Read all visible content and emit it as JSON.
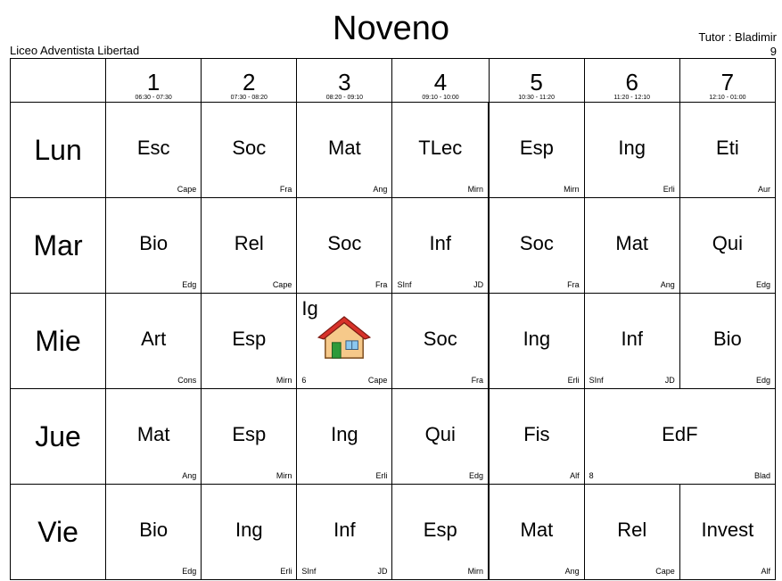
{
  "title": "Noveno",
  "school": "Liceo Adventista Libertad",
  "tutor": {
    "label": "Tutor : Bladimir",
    "group": "9"
  },
  "periods": [
    {
      "num": "1",
      "time": "06:30 - 07:30"
    },
    {
      "num": "2",
      "time": "07:30 - 08:20"
    },
    {
      "num": "3",
      "time": "08:20 - 09:10"
    },
    {
      "num": "4",
      "time": "09:10 - 10:00"
    },
    {
      "num": "5",
      "time": "10:30 - 11:20"
    },
    {
      "num": "6",
      "time": "11:20 - 12:10"
    },
    {
      "num": "7",
      "time": "12:10 - 01:00"
    }
  ],
  "days": [
    {
      "name": "Lun",
      "cells": [
        {
          "subject": "Esc",
          "room": "",
          "teacher": "Cape"
        },
        {
          "subject": "Soc",
          "room": "",
          "teacher": "Fra"
        },
        {
          "subject": "Mat",
          "room": "",
          "teacher": "Ang"
        },
        {
          "subject": "TLec",
          "room": "",
          "teacher": "Mirn"
        },
        {
          "subject": "Esp",
          "room": "",
          "teacher": "Mirn"
        },
        {
          "subject": "Ing",
          "room": "",
          "teacher": "Erli"
        },
        {
          "subject": "Eti",
          "room": "",
          "teacher": "Aur"
        }
      ]
    },
    {
      "name": "Mar",
      "cells": [
        {
          "subject": "Bio",
          "room": "",
          "teacher": "Edg"
        },
        {
          "subject": "Rel",
          "room": "",
          "teacher": "Cape"
        },
        {
          "subject": "Soc",
          "room": "",
          "teacher": "Fra"
        },
        {
          "subject": "Inf",
          "room": "SInf",
          "teacher": "JD"
        },
        {
          "subject": "Soc",
          "room": "",
          "teacher": "Fra"
        },
        {
          "subject": "Mat",
          "room": "",
          "teacher": "Ang"
        },
        {
          "subject": "Qui",
          "room": "",
          "teacher": "Edg"
        }
      ]
    },
    {
      "name": "Mie",
      "cells": [
        {
          "subject": "Art",
          "room": "",
          "teacher": "Cons"
        },
        {
          "subject": "Esp",
          "room": "",
          "teacher": "Mirn"
        },
        {
          "subject": "Ig",
          "room": "6",
          "teacher": "Cape",
          "icon": "house-icon"
        },
        {
          "subject": "Soc",
          "room": "",
          "teacher": "Fra"
        },
        {
          "subject": "Ing",
          "room": "",
          "teacher": "Erli"
        },
        {
          "subject": "Inf",
          "room": "SInf",
          "teacher": "JD"
        },
        {
          "subject": "Bio",
          "room": "",
          "teacher": "Edg"
        }
      ]
    },
    {
      "name": "Jue",
      "cells": [
        {
          "subject": "Mat",
          "room": "",
          "teacher": "Ang"
        },
        {
          "subject": "Esp",
          "room": "",
          "teacher": "Mirn"
        },
        {
          "subject": "Ing",
          "room": "",
          "teacher": "Erli"
        },
        {
          "subject": "Qui",
          "room": "",
          "teacher": "Edg"
        },
        {
          "subject": "Fis",
          "room": "",
          "teacher": "Alf"
        },
        {
          "subject": "EdF",
          "room": "8",
          "teacher": "Blad",
          "span": 2
        }
      ]
    },
    {
      "name": "Vie",
      "cells": [
        {
          "subject": "Bio",
          "room": "",
          "teacher": "Edg"
        },
        {
          "subject": "Ing",
          "room": "",
          "teacher": "Erli"
        },
        {
          "subject": "Inf",
          "room": "SInf",
          "teacher": "JD"
        },
        {
          "subject": "Esp",
          "room": "",
          "teacher": "Mirn"
        },
        {
          "subject": "Mat",
          "room": "",
          "teacher": "Ang"
        },
        {
          "subject": "Rel",
          "room": "",
          "teacher": "Cape"
        },
        {
          "subject": "Invest",
          "room": "",
          "teacher": "Alf"
        }
      ]
    }
  ]
}
